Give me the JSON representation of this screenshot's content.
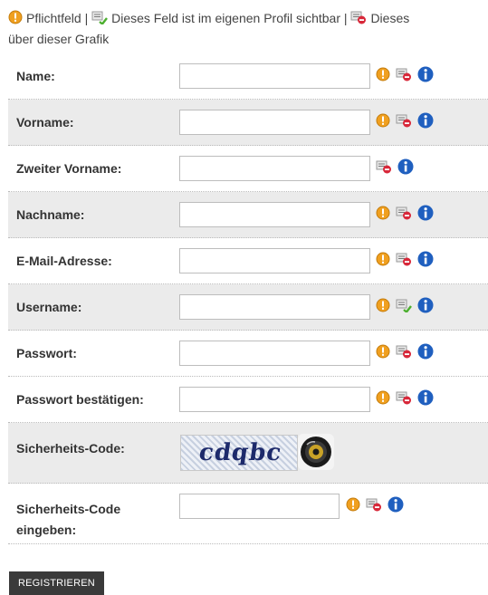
{
  "legend": {
    "required_label": "Pflichtfeld |",
    "visible_label": "Dieses Feld ist im eigenen Profil sichtbar |",
    "hidden_label_start": "Dieses",
    "hidden_label_end": "über dieser Grafik"
  },
  "fields": [
    {
      "label": "Name:",
      "value": "",
      "icons": [
        "required",
        "hidden",
        "info"
      ]
    },
    {
      "label": "Vorname:",
      "value": "",
      "icons": [
        "required",
        "hidden",
        "info"
      ]
    },
    {
      "label": "Zweiter Vorname:",
      "value": "",
      "icons": [
        "hidden",
        "info"
      ]
    },
    {
      "label": "Nachname:",
      "value": "",
      "icons": [
        "required",
        "hidden",
        "info"
      ]
    },
    {
      "label": "E-Mail-Adresse:",
      "value": "",
      "icons": [
        "required",
        "hidden",
        "info"
      ]
    },
    {
      "label": "Username:",
      "value": "",
      "icons": [
        "required",
        "visible",
        "info"
      ]
    },
    {
      "label": "Passwort:",
      "value": "",
      "icons": [
        "required",
        "hidden",
        "info"
      ]
    },
    {
      "label": "Passwort bestätigen:",
      "value": "",
      "icons": [
        "required",
        "hidden",
        "info"
      ]
    }
  ],
  "captcha": {
    "label": "Sicherheits-Code:",
    "image_text": "cdqbc"
  },
  "captcha_input": {
    "label_line1": "Sicherheits-Code",
    "label_line2": "eingeben:",
    "value": "",
    "icons": [
      "required",
      "hidden",
      "info"
    ]
  },
  "submit_label": "REGISTRIEREN",
  "colors": {
    "alt_row": "#ebebeb",
    "button_bg": "#3a3a3a",
    "info_blue": "#1f5fbf",
    "required_orange": "#f0a020",
    "hidden_red": "#d8283a",
    "visible_green": "#4caf2f"
  }
}
